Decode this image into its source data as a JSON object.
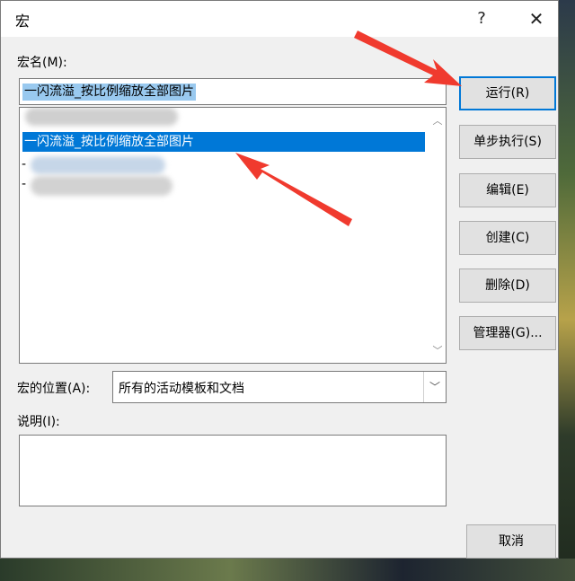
{
  "dialog": {
    "title": "宏",
    "help_label": "?",
    "close_label": "✕"
  },
  "macro_name": {
    "label": "宏名(M):",
    "value": "一闪流溢_按比例缩放全部图片"
  },
  "macro_list": {
    "selected_item": "一闪流溢_按比例缩放全部图片",
    "prefix_glyph": "-"
  },
  "location": {
    "label": "宏的位置(A):",
    "value": "所有的活动模板和文档"
  },
  "description": {
    "label": "说明(I):",
    "value": ""
  },
  "buttons": {
    "run": "运行(R)",
    "step": "单步执行(S)",
    "edit": "编辑(E)",
    "create": "创建(C)",
    "delete": "删除(D)",
    "organizer": "管理器(G)...",
    "cancel": "取消"
  },
  "colors": {
    "selection": "#0078d7",
    "highlight": "#99c9ef",
    "arrow": "#f03a2e"
  }
}
